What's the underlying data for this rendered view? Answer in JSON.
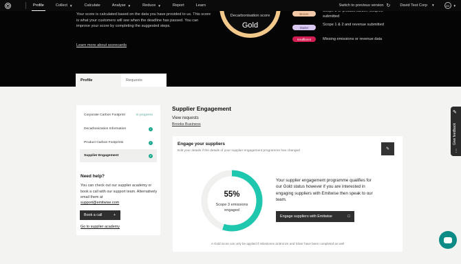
{
  "nav": {
    "items": [
      "Profile",
      "Collect",
      "Calculate",
      "Analyse",
      "Reduce",
      "Report",
      "Learn"
    ],
    "switch_version": "Switch to previous version",
    "org": "David Test Corp",
    "avatar_initials": "DD"
  },
  "hero": {
    "description": "Your score is calculated based on the data you have provided to us. This score is what your customers will see when the deadline has passed. You can improve your score by completing the suggested steps.",
    "learn_more": "Learn more about scorecards",
    "score_label": "Decarbonisation score",
    "score_value": "Gold",
    "legend": [
      {
        "pill": "Bronze",
        "text": "Scope 3 or product carbon footprint submitted",
        "bg": "#f2c9a8",
        "fg": "#7a4a2a"
      },
      {
        "pill": "Starter",
        "text": "Scope 1 & 2 and revenue submitted",
        "bg": "#d9c8f2",
        "fg": "#4b3270"
      },
      {
        "pill": "Insufficient",
        "text": "Missing emissions or revenue data",
        "bg": "#d21e52",
        "fg": "#ffffff"
      }
    ]
  },
  "tabs": [
    "Profile",
    "Requests"
  ],
  "sidebar": {
    "items": [
      {
        "label": "Corporate Carbon Footprint",
        "status": "In progress"
      },
      {
        "label": "Decarbonization Information",
        "status": "done"
      },
      {
        "label": "Product Carbon Footprints",
        "status": "done"
      },
      {
        "label": "Supplier Engagement",
        "status": "done"
      }
    ],
    "help_title": "Need help?",
    "help_text": "You can check out our supplier academy or book a call with our support team. Alternatively email them at",
    "help_email": "support@emitwise.com",
    "book_call": "Book a call",
    "academy_link": "Go to supplier academy"
  },
  "main": {
    "title": "Supplier Engagement",
    "view_requests": "View requests",
    "request_link": "Brooks Business",
    "card": {
      "title": "Engage your suppliers",
      "subtitle": "Edit your details if the details of your supplier engagement programme has changed",
      "percent_value": 55,
      "percent": "55%",
      "percent_label": "Scope 3 emissions engaged",
      "description": "Your supplier engagement programme qualifies for our Gold status however if you are interested in engaging suppliers with Emitwise then speak to our team.",
      "button": "Engage suppliers with Emitwise",
      "footnote": "A Gold score can only be applied if milestones at Bronze and Silver have been completed as well"
    }
  },
  "feedback": "Give feedback",
  "colors": {
    "accent": "#1fc7ae",
    "gold": "#f2c98a",
    "dark": "#2f2f2f"
  }
}
